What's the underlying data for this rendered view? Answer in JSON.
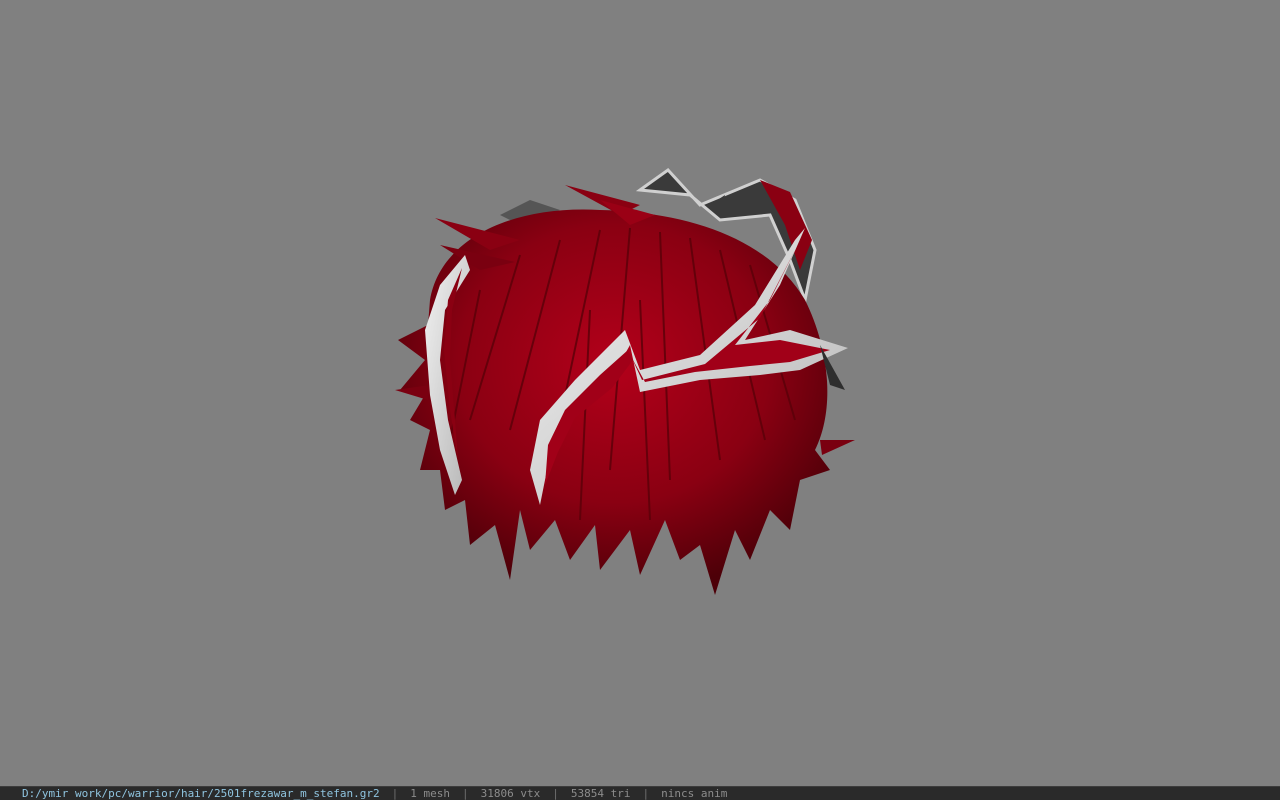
{
  "viewer": {
    "background_color": "#808080",
    "model": {
      "icon": "hair-model-icon",
      "hair_color": "#8a0012",
      "band_color": "#e6e6e6"
    }
  },
  "status_bar": {
    "file_path": "D:/ymir work/pc/warrior/hair/2501frezawar_m_stefan.gr2",
    "separator": "|",
    "mesh_count": "1 mesh",
    "vertex_count": "31806 vtx",
    "triangle_count": "53854 tri",
    "animation": "nincs anim"
  }
}
